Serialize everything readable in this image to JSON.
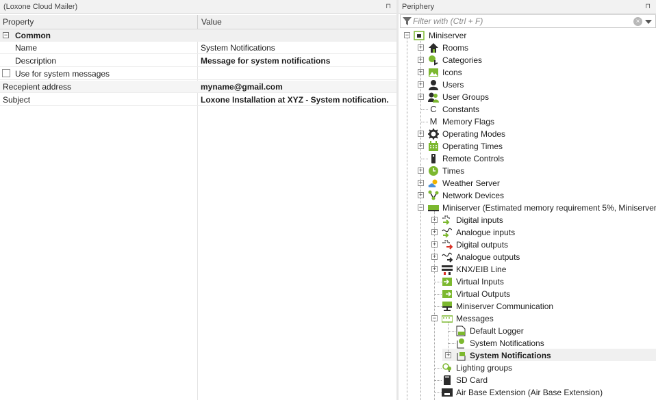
{
  "left_panel": {
    "title": "(Loxone Cloud Mailer)",
    "pin": "⊓",
    "columns": {
      "property": "Property",
      "value": "Value"
    },
    "category": {
      "expander": "−",
      "label": "Common"
    },
    "rows": [
      {
        "key": "Name",
        "value": "System Notifications"
      },
      {
        "key": "Description",
        "value": "Message for system notifications"
      },
      {
        "key": "Use for system messages",
        "value": ""
      },
      {
        "key": "Recepient address",
        "value": "myname@gmail.com"
      },
      {
        "key": "Subject",
        "value": "Loxone Installation at XYZ - System notification."
      }
    ]
  },
  "right_panel": {
    "title": "Periphery",
    "pin": "⊓",
    "filter": {
      "placeholder": "Filter with (Ctrl + F)",
      "clear": "×"
    },
    "tree": {
      "root": "Miniserver",
      "items": [
        "Rooms",
        "Categories",
        "Icons",
        "Users",
        "User Groups",
        "Constants",
        "Memory Flags",
        "Operating Modes",
        "Operating Times",
        "Remote Controls",
        "Times",
        "Weather Server",
        "Network Devices",
        "Miniserver (Estimated memory requirement 5%, Miniserver",
        "Digital inputs",
        "Analogue inputs",
        "Digital outputs",
        "Analogue outputs",
        "KNX/EIB Line",
        "Virtual Inputs",
        "Virtual Outputs",
        "Miniserver Communication",
        "Messages",
        "Default Logger",
        "System Notifications",
        "System Notifications",
        "Lighting groups",
        "SD Card",
        "Air Base Extension (Air Base Extension)"
      ],
      "glyphs": {
        "constants": "C",
        "memory": "M",
        "plus": "+",
        "minus": "−"
      }
    },
    "colors": {
      "accent": "#7cb82f",
      "dark": "#2b2b2b"
    }
  }
}
